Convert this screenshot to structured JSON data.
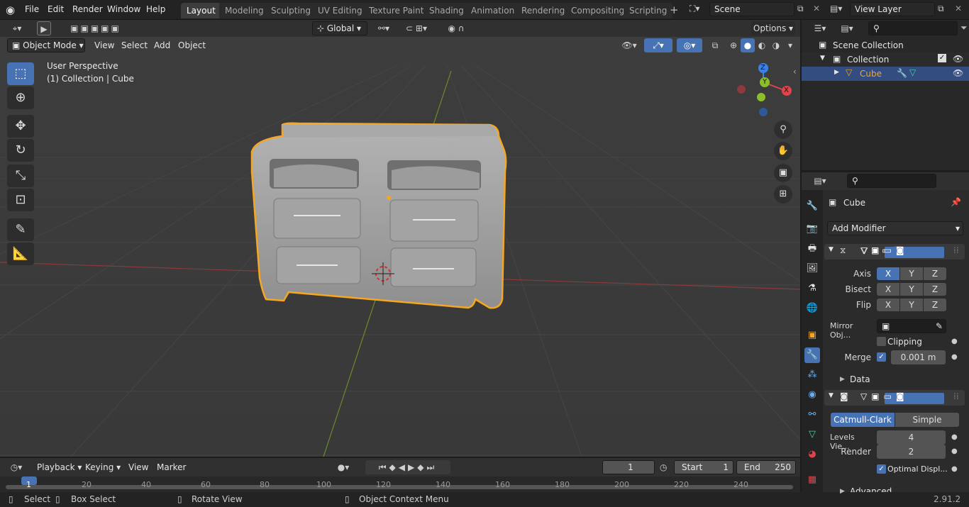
{
  "menu": {
    "file": "File",
    "edit": "Edit",
    "render": "Render",
    "window": "Window",
    "help": "Help"
  },
  "workspaces": [
    {
      "label": "Layout"
    },
    {
      "label": "Modeling"
    },
    {
      "label": "Sculpting"
    },
    {
      "label": "UV Editing"
    },
    {
      "label": "Texture Paint"
    },
    {
      "label": "Shading"
    },
    {
      "label": "Animation"
    },
    {
      "label": "Rendering"
    },
    {
      "label": "Compositing"
    },
    {
      "label": "Scripting"
    }
  ],
  "scene": {
    "name": "Scene"
  },
  "view_layer": {
    "name": "View Layer"
  },
  "viewport": {
    "mode": "Object Mode",
    "menu_view": "View",
    "menu_select": "Select",
    "menu_add": "Add",
    "menu_object": "Object",
    "orientation": "Global",
    "options": "Options",
    "overlay_title": "User Perspective",
    "overlay_subtitle": "(1) Collection | Cube",
    "gizmo": {
      "x": "X",
      "y": "Y",
      "z": "Z"
    },
    "colors": {
      "x_axis": "#e0434a",
      "y_axis": "#8bbf2a",
      "z_axis": "#3b82e8",
      "selection": "#f5a623"
    }
  },
  "timeline": {
    "playback": "Playback",
    "keying": "Keying",
    "view": "View",
    "marker": "Marker",
    "current_frame": "1",
    "start_label": "Start",
    "start": "1",
    "end_label": "End",
    "end": "250",
    "ticks": [
      "1",
      "20",
      "40",
      "60",
      "80",
      "100",
      "120",
      "140",
      "160",
      "180",
      "200",
      "220",
      "240"
    ]
  },
  "status": {
    "select": "Select",
    "box_select": "Box Select",
    "rotate": "Rotate View",
    "context": "Object Context Menu",
    "version": "2.91.2"
  },
  "outliner": {
    "scene_collection": "Scene Collection",
    "collection": "Collection",
    "object": "Cube"
  },
  "properties": {
    "object_name": "Cube",
    "add_modifier": "Add Modifier",
    "mirror": {
      "axis_label": "Axis",
      "bisect_label": "Bisect",
      "flip_label": "Flip",
      "x": "X",
      "y": "Y",
      "z": "Z",
      "mirror_object_label": "Mirror Obj...",
      "clipping_label": "Clipping",
      "merge_label": "Merge",
      "merge_value": "0.001 m",
      "data_label": "Data"
    },
    "subsurf": {
      "catmull": "Catmull-Clark",
      "simple": "Simple",
      "levels_viewport_label": "Levels Vie...",
      "levels_viewport": "4",
      "render_label": "Render",
      "render": "2",
      "optimal_label": "Optimal Displ...",
      "advanced_label": "Advanced"
    }
  }
}
